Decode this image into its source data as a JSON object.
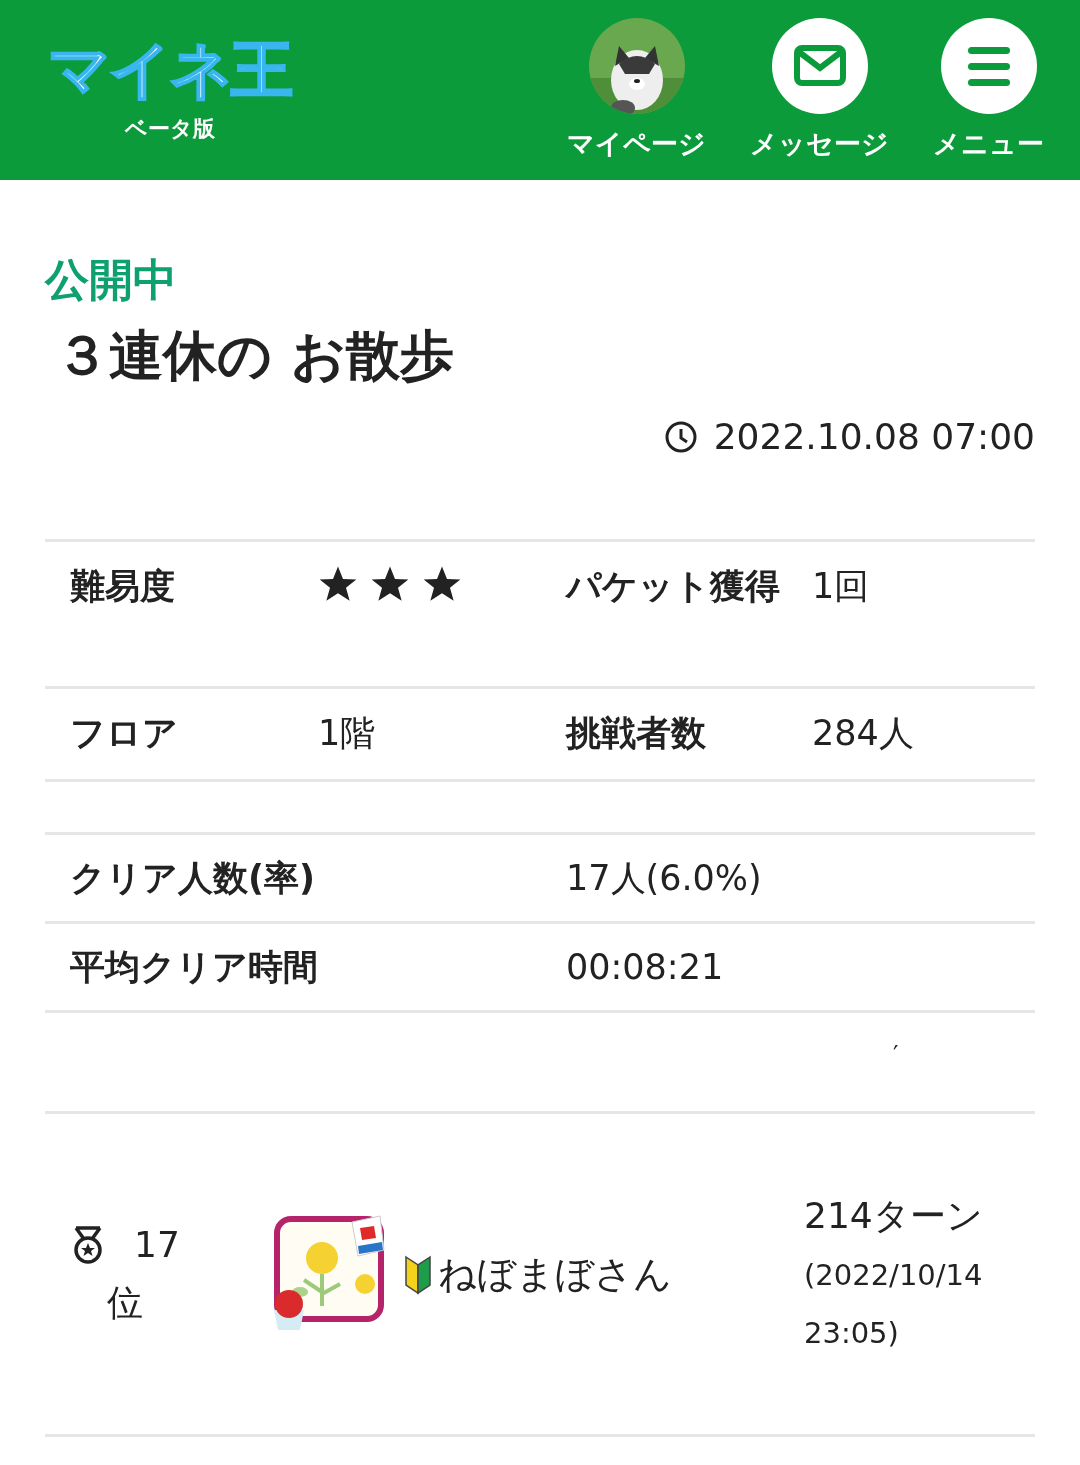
{
  "header": {
    "logo": "マイネ王",
    "logo_sub": "ベータ版",
    "nav": [
      {
        "kind": "avatar",
        "label": "マイページ"
      },
      {
        "kind": "mail",
        "label": "メッセージ"
      },
      {
        "kind": "menu",
        "label": "メニュー"
      }
    ]
  },
  "status": "公開中",
  "title": "３連休の お散歩",
  "datetime": "2022.10.08 07:00",
  "stats": [
    {
      "label": "難易度",
      "kind": "stars",
      "stars": 3,
      "label2": "パケット獲得",
      "value2": "1回"
    },
    {
      "label": "フロア",
      "kind": "text",
      "value": "1階",
      "label2": "挑戦者数",
      "value2": "284人"
    }
  ],
  "summary": [
    {
      "label": "クリア人数(率)",
      "value": "17人(6.0%)"
    },
    {
      "label": "平均クリア時間",
      "value": "00:08:21"
    }
  ],
  "stray_mark": "′",
  "ranking": [
    {
      "rank": "17",
      "rank_suffix": "位",
      "name": "ねぼまぼさん",
      "turns": "214ターン",
      "date": "(2022/10/14 23:05)"
    }
  ]
}
